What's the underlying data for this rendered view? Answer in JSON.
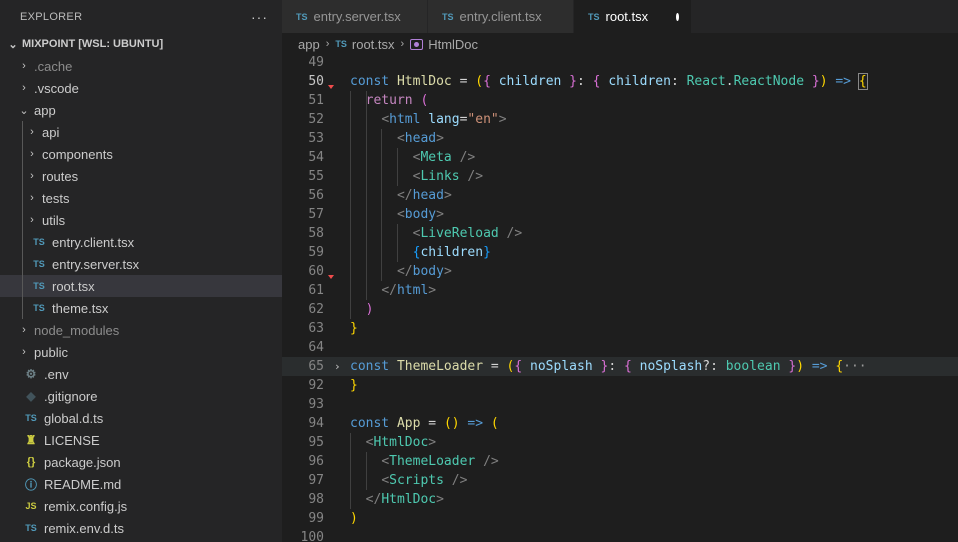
{
  "explorer": {
    "title": "EXPLORER",
    "more": "···",
    "root": "MIXPOINT [WSL: UBUNTU]"
  },
  "tree": [
    {
      "label": ".cache",
      "kind": "folder",
      "depth": 0,
      "dim": true
    },
    {
      "label": ".vscode",
      "kind": "folder",
      "depth": 0
    },
    {
      "label": "app",
      "kind": "folder-open",
      "depth": 0
    },
    {
      "label": "api",
      "kind": "folder",
      "depth": 1
    },
    {
      "label": "components",
      "kind": "folder",
      "depth": 1
    },
    {
      "label": "routes",
      "kind": "folder",
      "depth": 1
    },
    {
      "label": "tests",
      "kind": "folder",
      "depth": 1
    },
    {
      "label": "utils",
      "kind": "folder",
      "depth": 1
    },
    {
      "label": "entry.client.tsx",
      "kind": "ts",
      "depth": 1
    },
    {
      "label": "entry.server.tsx",
      "kind": "ts",
      "depth": 1
    },
    {
      "label": "root.tsx",
      "kind": "ts",
      "depth": 1,
      "selected": true
    },
    {
      "label": "theme.tsx",
      "kind": "ts",
      "depth": 1
    },
    {
      "label": "node_modules",
      "kind": "folder",
      "depth": 0,
      "dim": true
    },
    {
      "label": "public",
      "kind": "folder",
      "depth": 0
    },
    {
      "label": ".env",
      "kind": "env",
      "depth": 0
    },
    {
      "label": ".gitignore",
      "kind": "git",
      "depth": 0
    },
    {
      "label": "global.d.ts",
      "kind": "ts",
      "depth": 0
    },
    {
      "label": "LICENSE",
      "kind": "lic",
      "depth": 0
    },
    {
      "label": "package.json",
      "kind": "json",
      "depth": 0
    },
    {
      "label": "README.md",
      "kind": "md",
      "depth": 0
    },
    {
      "label": "remix.config.js",
      "kind": "js",
      "depth": 0
    },
    {
      "label": "remix.env.d.ts",
      "kind": "ts",
      "depth": 0
    }
  ],
  "icons": {
    "ts": "TS",
    "js": "JS",
    "json": "{}",
    "git": "◆",
    "env": "⚙",
    "lic": "♜",
    "md": "ⓘ",
    "folder": "›",
    "folder-open": "⌄"
  },
  "tabs": [
    {
      "label": "entry.server.tsx",
      "active": false
    },
    {
      "label": "entry.client.tsx",
      "active": false
    },
    {
      "label": "root.tsx",
      "active": true,
      "dirty": true
    }
  ],
  "breadcrumb": {
    "folder": "app",
    "file": "root.tsx",
    "symbol": "HtmlDoc"
  },
  "current_line": "50",
  "lines": [
    {
      "n": "49",
      "segs": []
    },
    {
      "n": "50",
      "err": true,
      "segs": [
        [
          "k",
          "const "
        ],
        [
          "f",
          "HtmlDoc"
        ],
        [
          "o",
          " = "
        ],
        [
          "b1",
          "("
        ],
        [
          "b2",
          "{ "
        ],
        [
          "v",
          "children"
        ],
        [
          "b2",
          " }"
        ],
        [
          "o",
          ": "
        ],
        [
          "b2",
          "{ "
        ],
        [
          "v",
          "children"
        ],
        [
          "o",
          ": "
        ],
        [
          "t",
          "React"
        ],
        [
          "o",
          "."
        ],
        [
          "t",
          "ReactNode"
        ],
        [
          "b2",
          " }"
        ],
        [
          "b1",
          ")"
        ],
        [
          "k",
          " => "
        ],
        [
          "b1",
          "{"
        ]
      ]
    },
    {
      "n": "51",
      "segs": [
        [
          "o",
          "  "
        ],
        [
          "c",
          "return "
        ],
        [
          "b2",
          "("
        ]
      ]
    },
    {
      "n": "52",
      "segs": [
        [
          "o",
          "    "
        ],
        [
          "g",
          "<"
        ],
        [
          "k",
          "html "
        ],
        [
          "v",
          "lang"
        ],
        [
          "o",
          "="
        ],
        [
          "s",
          "\"en\""
        ],
        [
          "g",
          ">"
        ]
      ]
    },
    {
      "n": "53",
      "segs": [
        [
          "o",
          "      "
        ],
        [
          "g",
          "<"
        ],
        [
          "k",
          "head"
        ],
        [
          "g",
          ">"
        ]
      ]
    },
    {
      "n": "54",
      "segs": [
        [
          "o",
          "        "
        ],
        [
          "g",
          "<"
        ],
        [
          "t",
          "Meta "
        ],
        [
          "g",
          "/>"
        ]
      ]
    },
    {
      "n": "55",
      "segs": [
        [
          "o",
          "        "
        ],
        [
          "g",
          "<"
        ],
        [
          "t",
          "Links "
        ],
        [
          "g",
          "/>"
        ]
      ]
    },
    {
      "n": "56",
      "segs": [
        [
          "o",
          "      "
        ],
        [
          "g",
          "</"
        ],
        [
          "k",
          "head"
        ],
        [
          "g",
          ">"
        ]
      ]
    },
    {
      "n": "57",
      "segs": [
        [
          "o",
          "      "
        ],
        [
          "g",
          "<"
        ],
        [
          "k",
          "body"
        ],
        [
          "g",
          ">"
        ]
      ]
    },
    {
      "n": "58",
      "segs": [
        [
          "o",
          "        "
        ],
        [
          "g",
          "<"
        ],
        [
          "t",
          "LiveReload "
        ],
        [
          "g",
          "/>"
        ]
      ]
    },
    {
      "n": "59",
      "segs": [
        [
          "o",
          "        "
        ],
        [
          "b3",
          "{"
        ],
        [
          "v",
          "children"
        ],
        [
          "b3",
          "}"
        ]
      ]
    },
    {
      "n": "60",
      "err": true,
      "segs": [
        [
          "o",
          "      "
        ],
        [
          "g",
          "</"
        ],
        [
          "k",
          "body"
        ],
        [
          "g",
          ">"
        ]
      ]
    },
    {
      "n": "61",
      "segs": [
        [
          "o",
          "    "
        ],
        [
          "g",
          "</"
        ],
        [
          "k",
          "html"
        ],
        [
          "g",
          ">"
        ]
      ]
    },
    {
      "n": "62",
      "segs": [
        [
          "o",
          "  "
        ],
        [
          "b2",
          ")"
        ]
      ]
    },
    {
      "n": "63",
      "segs": [
        [
          "b1",
          "}"
        ]
      ]
    },
    {
      "n": "64",
      "segs": []
    },
    {
      "n": "65",
      "fold": true,
      "hl": true,
      "segs": [
        [
          "k",
          "const "
        ],
        [
          "f",
          "ThemeLoader"
        ],
        [
          "o",
          " = "
        ],
        [
          "b1",
          "("
        ],
        [
          "b2",
          "{ "
        ],
        [
          "v",
          "noSplash"
        ],
        [
          "b2",
          " }"
        ],
        [
          "o",
          ": "
        ],
        [
          "b2",
          "{ "
        ],
        [
          "v",
          "noSplash"
        ],
        [
          "o",
          "?: "
        ],
        [
          "t",
          "boolean"
        ],
        [
          "b2",
          " }"
        ],
        [
          "b1",
          ")"
        ],
        [
          "k",
          " => "
        ],
        [
          "b1",
          "{"
        ],
        [
          "ell",
          "···"
        ]
      ]
    },
    {
      "n": "92",
      "segs": [
        [
          "b1",
          "}"
        ]
      ]
    },
    {
      "n": "93",
      "segs": []
    },
    {
      "n": "94",
      "segs": [
        [
          "k",
          "const "
        ],
        [
          "f",
          "App"
        ],
        [
          "o",
          " = "
        ],
        [
          "b1",
          "()"
        ],
        [
          "k",
          " => "
        ],
        [
          "b1",
          "("
        ]
      ]
    },
    {
      "n": "95",
      "segs": [
        [
          "o",
          "  "
        ],
        [
          "g",
          "<"
        ],
        [
          "t",
          "HtmlDoc"
        ],
        [
          "g",
          ">"
        ]
      ]
    },
    {
      "n": "96",
      "segs": [
        [
          "o",
          "    "
        ],
        [
          "g",
          "<"
        ],
        [
          "t",
          "ThemeLoader "
        ],
        [
          "g",
          "/>"
        ]
      ]
    },
    {
      "n": "97",
      "segs": [
        [
          "o",
          "    "
        ],
        [
          "g",
          "<"
        ],
        [
          "t",
          "Scripts "
        ],
        [
          "g",
          "/>"
        ]
      ]
    },
    {
      "n": "98",
      "segs": [
        [
          "o",
          "  "
        ],
        [
          "g",
          "</"
        ],
        [
          "t",
          "HtmlDoc"
        ],
        [
          "g",
          ">"
        ]
      ]
    },
    {
      "n": "99",
      "segs": [
        [
          "b1",
          ")"
        ]
      ]
    },
    {
      "n": "100",
      "segs": []
    }
  ]
}
